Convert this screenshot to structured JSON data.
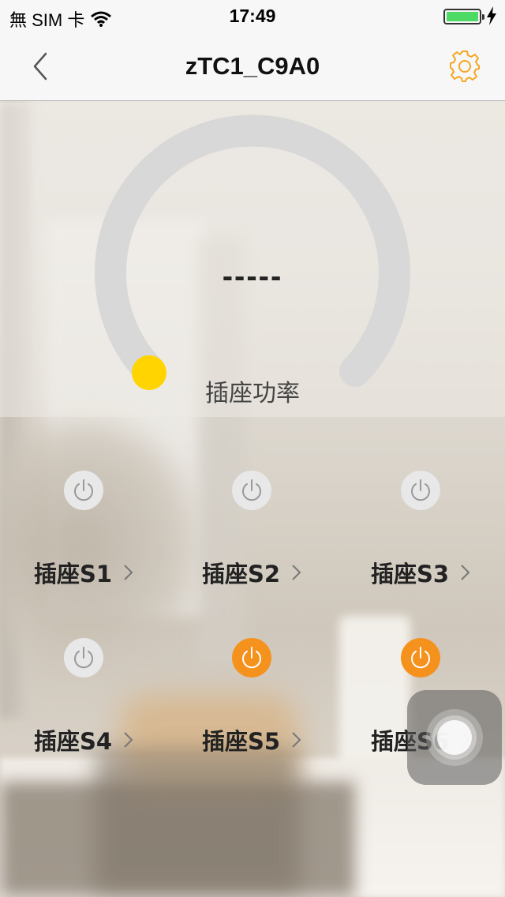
{
  "status_bar": {
    "carrier": "無 SIM 卡",
    "time": "17:49",
    "battery_percent": 100,
    "battery_color": "#4cd964"
  },
  "nav": {
    "title": "zTC1_C9A0",
    "back_icon": "chevron-left-icon",
    "settings_icon": "gear-icon",
    "accent_color": "#f5a623"
  },
  "gauge": {
    "value": "-----",
    "label": "插座功率",
    "knob_color": "#ffd400",
    "track_color": "#d8d8d8",
    "level": 0
  },
  "sockets": [
    {
      "name": "插座S1",
      "on": false
    },
    {
      "name": "插座S2",
      "on": false
    },
    {
      "name": "插座S3",
      "on": false
    },
    {
      "name": "插座S4",
      "on": false
    },
    {
      "name": "插座S5",
      "on": true
    },
    {
      "name": "插座S6",
      "on": true
    }
  ],
  "colors": {
    "power_on": "#f5921e",
    "power_off": "#e8e8e8"
  }
}
